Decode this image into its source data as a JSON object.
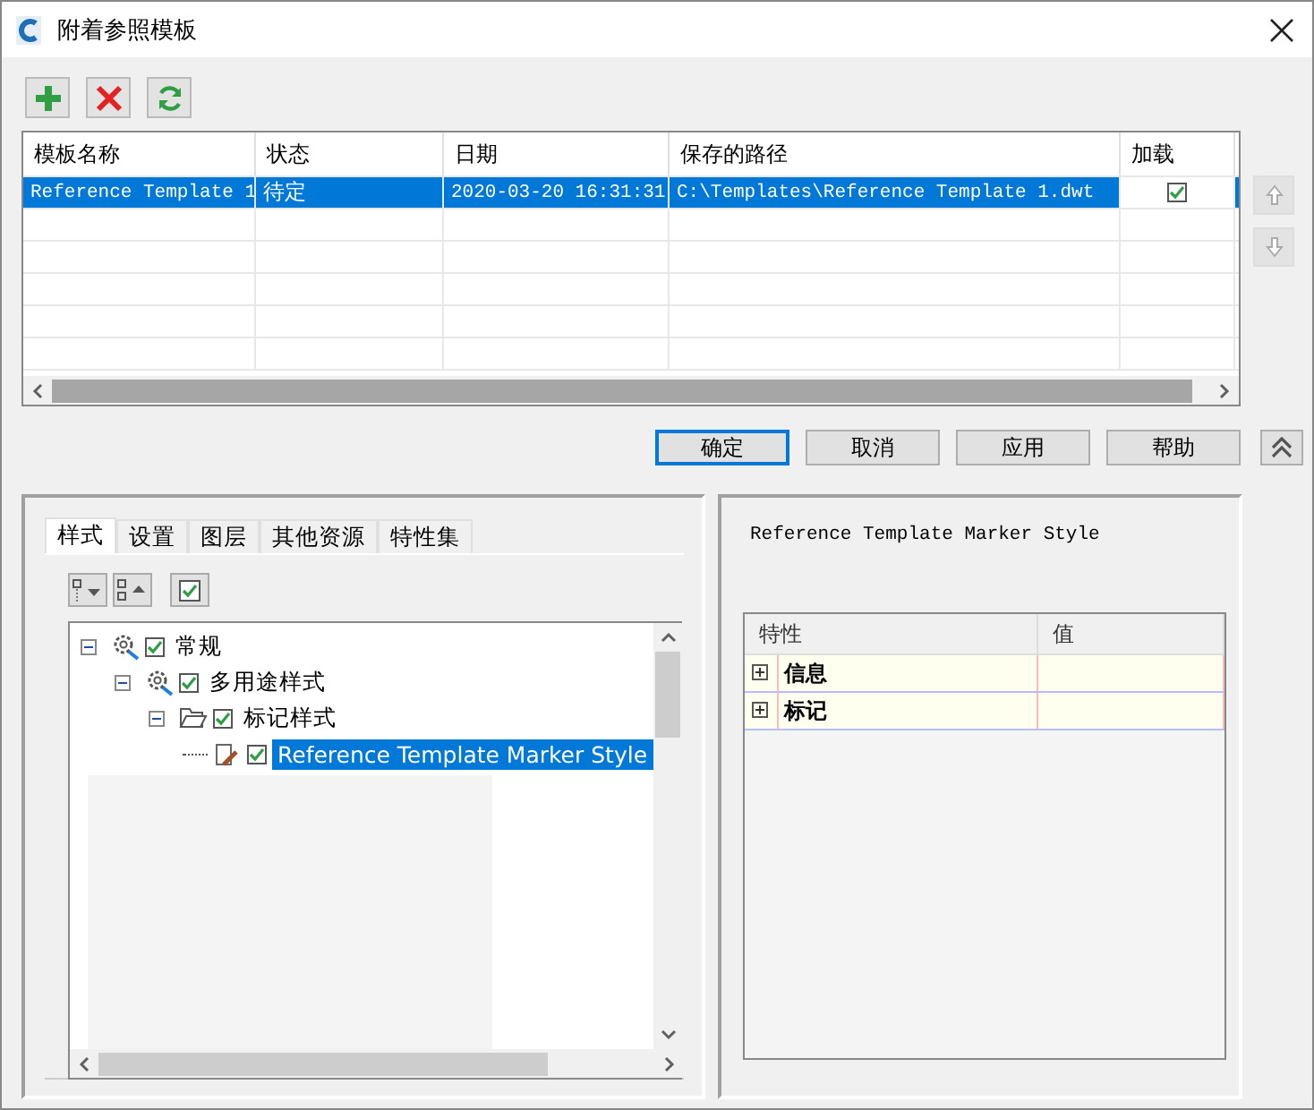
{
  "window": {
    "title": "附着参照模板"
  },
  "table": {
    "columns": [
      "模板名称",
      "状态",
      "日期",
      "保存的路径",
      "加载"
    ],
    "rows": [
      {
        "name": "Reference Template 1",
        "status": "待定",
        "date": "2020-03-20 16:31:31",
        "path": "C:\\Templates\\Reference Template 1.dwt",
        "loaded": true,
        "selected": true
      }
    ]
  },
  "buttons": [
    "确定",
    "取消",
    "应用",
    "帮助"
  ],
  "tabs": [
    {
      "label": "样式",
      "selected": true
    },
    {
      "label": "设置",
      "selected": false
    },
    {
      "label": "图层",
      "selected": false
    },
    {
      "label": "其他资源",
      "selected": false
    },
    {
      "label": "特性集",
      "selected": false
    }
  ],
  "tree": [
    {
      "label": "常规",
      "kind": "gear",
      "checked": true,
      "expanded": true,
      "selected": false,
      "children": [
        {
          "label": "多用途样式",
          "kind": "gear",
          "checked": true,
          "expanded": true,
          "selected": false,
          "children": [
            {
              "label": "标记样式",
              "kind": "folder",
              "checked": true,
              "expanded": true,
              "selected": false,
              "children": [
                {
                  "label": "Reference Template Marker Style",
                  "kind": "style",
                  "checked": true,
                  "selected": true
                }
              ]
            }
          ]
        }
      ]
    }
  ],
  "details": {
    "style_name": "Reference Template Marker Style",
    "grid": {
      "columns": [
        "特性",
        "值"
      ],
      "rows": [
        {
          "label": "信息",
          "expanded": false
        },
        {
          "label": "标记",
          "expanded": false
        }
      ]
    }
  }
}
